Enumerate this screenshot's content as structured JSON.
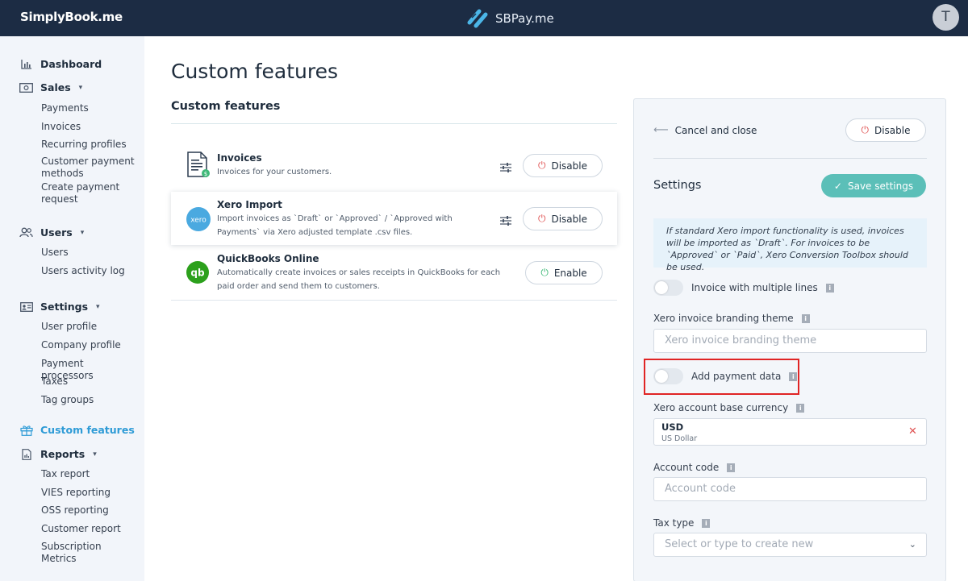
{
  "header": {
    "brand": "SimplyBook.me",
    "center_logo": "SBPay.me",
    "avatar_initial": "T"
  },
  "sidebar": {
    "dashboard": "Dashboard",
    "sales": "Sales",
    "sales_items": [
      "Payments",
      "Invoices",
      "Recurring profiles",
      "Customer payment methods",
      "Create payment request"
    ],
    "users": "Users",
    "users_items": [
      "Users",
      "Users activity log"
    ],
    "settings": "Settings",
    "settings_items": [
      "User profile",
      "Company profile",
      "Payment processors",
      "Taxes",
      "Tag groups"
    ],
    "custom_features": "Custom features",
    "reports": "Reports",
    "reports_items": [
      "Tax report",
      "VIES reporting",
      "OSS reporting",
      "Customer report",
      "Subscription Metrics"
    ]
  },
  "main": {
    "page_title": "Custom features",
    "section_title": "Custom features",
    "features": [
      {
        "title": "Invoices",
        "description": "Invoices for your customers.",
        "button": "Disable"
      },
      {
        "title": "Xero Import",
        "description": "Import invoices as `Draft` or `Approved` / `Approved with Payments` via Xero adjusted template .csv files.",
        "button": "Disable"
      },
      {
        "title": "QuickBooks Online",
        "description": "Automatically create invoices or sales receipts in QuickBooks for each paid order and send them to customers.",
        "button": "Enable"
      }
    ]
  },
  "panel": {
    "cancel_label": "Cancel and close",
    "disable_label": "Disable",
    "settings_label": "Settings",
    "save_label": "Save settings",
    "notice": "If standard Xero import functionality is used, invoices will be imported as `Draft`. For invoices to be `Approved` or `Paid`, Xero Conversion Toolbox should be used.",
    "multiple_lines_label": "Invoice with multiple lines",
    "multiple_lines_on": false,
    "branding_label": "Xero invoice branding theme",
    "branding_placeholder": "Xero invoice branding theme",
    "payment_data_label": "Add payment data",
    "payment_data_on": false,
    "currency_label": "Xero account base currency",
    "currency_code": "USD",
    "currency_name": "US Dollar",
    "account_code_label": "Account code",
    "account_code_placeholder": "Account code",
    "tax_type_label": "Tax type",
    "tax_type_placeholder": "Select or type to create new"
  },
  "icons": {
    "info": "i",
    "close": "✕",
    "chevron": "⌄"
  },
  "colors": {
    "header_bg": "#1c2c44",
    "sidebar_bg": "#f2f5fa",
    "accent": "#2e9bd6",
    "save_button": "#5bbfb8",
    "disable_icon": "#e05454",
    "enable_icon": "#3fb978",
    "highlight_box": "#e02424"
  }
}
